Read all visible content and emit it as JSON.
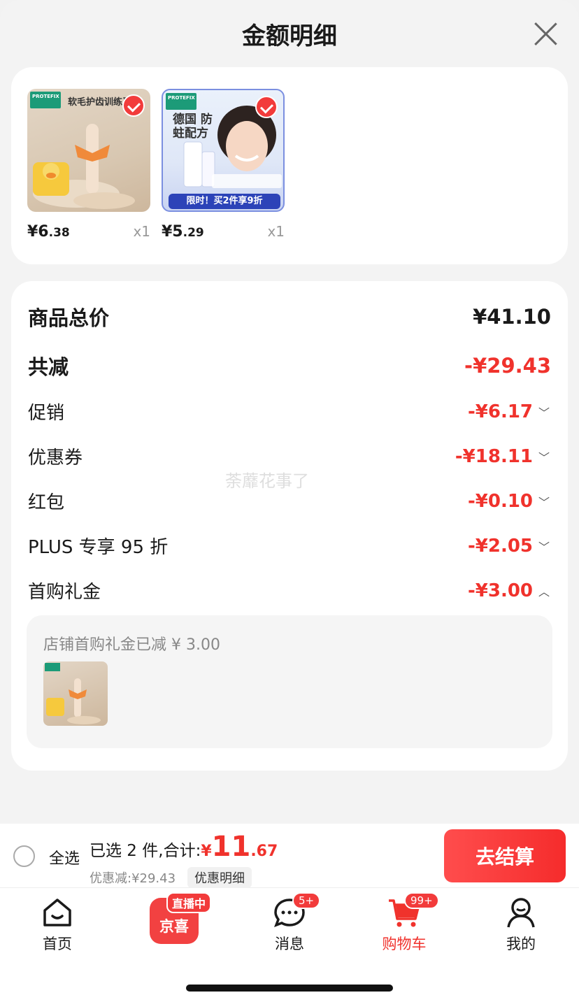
{
  "sheet": {
    "title": "金额明细"
  },
  "products": [
    {
      "thumb_brand": "PROTEFIX",
      "thumb_title": "软毛护齿训练牙刷",
      "price_int": "¥6",
      "price_dec": ".38",
      "qty": "x1"
    },
    {
      "thumb_brand": "PROTEFIX",
      "thumb_title": "德国 防蛀配方",
      "thumb_promo": "限时！买2件享9折",
      "price_int": "¥5",
      "price_dec": ".29",
      "qty": "x1"
    }
  ],
  "breakdown": {
    "total_label": "商品总价",
    "total_amount": "¥41.10",
    "reduce_label": "共减",
    "reduce_amount": "-¥29.43",
    "items": [
      {
        "label": "促销",
        "amount": "-¥6.17"
      },
      {
        "label": "优惠券",
        "amount": "-¥18.11"
      },
      {
        "label": "红包",
        "amount": "-¥0.10"
      },
      {
        "label": "PLUS 专享 95 折",
        "amount": "-¥2.05"
      },
      {
        "label": "首购礼金",
        "amount": "-¥3.00"
      }
    ],
    "detail_text": "店铺首购礼金已减 ¥ 3.00"
  },
  "watermark": "荼蘼花事了",
  "checkout": {
    "select_all": "全选",
    "summary_prefix": "已选 2 件,合计:",
    "total_sign": "¥",
    "total_int": "11",
    "total_dec": ".67",
    "discount": "优惠减:¥29.43",
    "detail_link": "优惠明细",
    "checkout_button": "去结算"
  },
  "tabbar": {
    "home": "首页",
    "live_tag": "直播中",
    "live_label": "京喜",
    "messages": "消息",
    "messages_badge": "5+",
    "cart": "购物车",
    "cart_badge": "99+",
    "me": "我的"
  },
  "colors": {
    "accent": "#f0322c"
  }
}
